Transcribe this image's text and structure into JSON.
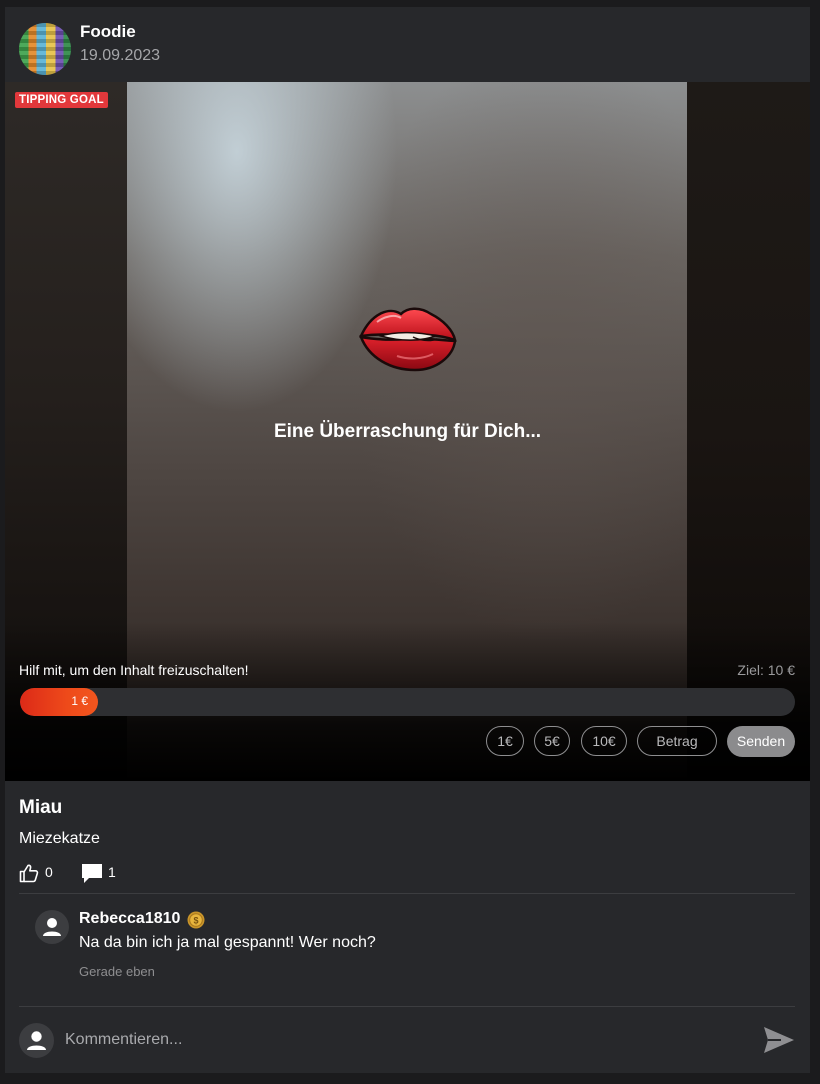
{
  "post": {
    "author": "Foodie",
    "date": "19.09.2023",
    "badge": "TIPPING GOAL",
    "overlay_text": "Eine Überraschung für Dich...",
    "help_text": "Hilf mit, um den Inhalt freizuschalten!",
    "goal_text": "Ziel: 10 €",
    "progress": {
      "current_label": "1 €",
      "current": 1,
      "goal": 10,
      "fill_fraction": 0.1
    },
    "tip_buttons": [
      "1€",
      "5€",
      "10€",
      "Betrag"
    ],
    "send_label": "Senden",
    "title": "Miau",
    "text": "Miezekatze",
    "likes": "0",
    "comments_count": "1"
  },
  "comments": [
    {
      "user": "Rebecca1810",
      "text": "Na da bin ich ja mal gespannt! Wer noch?",
      "time": "Gerade eben"
    }
  ],
  "composer": {
    "placeholder": "Kommentieren..."
  },
  "icons": {
    "lips": "lips-icon",
    "like": "thumbs-up-icon",
    "comment": "comment-bubble-icon",
    "coin": "coin-icon",
    "user": "user-icon",
    "send": "send-icon"
  },
  "colors": {
    "badge": "#e2383b",
    "progress": "#e63b1b",
    "background": "#27282b",
    "send_button": "#8b8b8d"
  }
}
